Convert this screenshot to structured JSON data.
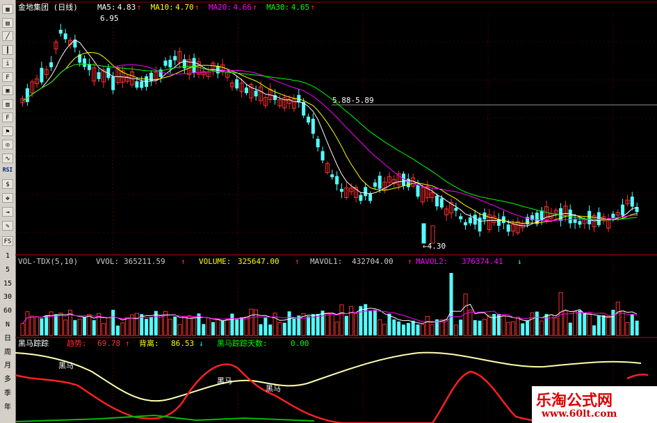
{
  "window": {
    "title": "金地集团 (日线)"
  },
  "toolbar": {
    "buttons": [
      {
        "icon": "grid-icon"
      },
      {
        "icon": "table-icon"
      },
      {
        "icon": "line-icon"
      },
      {
        "icon": "candle-icon"
      },
      {
        "icon": "info-icon"
      },
      {
        "icon": "f10-icon"
      },
      {
        "icon": "document-icon"
      },
      {
        "icon": "chart-icon"
      },
      {
        "icon": "f2-icon"
      },
      {
        "icon": "flag-icon"
      },
      {
        "icon": "zoom-icon"
      },
      {
        "icon": "wave-icon"
      }
    ],
    "rsi_label": "RSI",
    "tools": [
      {
        "icon": "money-icon"
      },
      {
        "icon": "move-icon"
      },
      {
        "icon": "exit-icon"
      },
      {
        "icon": "pencil-icon"
      }
    ],
    "fs_label": "FS",
    "periods": [
      "1",
      "5",
      "15",
      "30",
      "60",
      "N",
      "日",
      "周",
      "月",
      "多",
      "季",
      "年"
    ]
  },
  "main_panel": {
    "title": "金地集团 (日线)",
    "indicators": [
      {
        "label": "MA5:",
        "value": "4.83",
        "arrow": "↑",
        "color": "#ffffff"
      },
      {
        "label": "MA10:",
        "value": "4.70",
        "arrow": "↑",
        "color": "#ffff00"
      },
      {
        "label": "MA20:",
        "value": "4.66",
        "arrow": "↑",
        "color": "#ff00ff"
      },
      {
        "label": "MA30:",
        "value": "4.65",
        "arrow": "↑",
        "color": "#00ff00"
      }
    ],
    "high_label": "6.95",
    "mid_label": "5.88-5.89",
    "low_label": "←4.30"
  },
  "volume_panel": {
    "title": "VOL-TDX(5,10)",
    "vvol_label": "VVOL:",
    "vvol_value": "365211.59",
    "vvol_arrow": "↑",
    "volume_label": "VOLUME:",
    "volume_value": "325647.00",
    "volume_arrow": "↑",
    "mavol1_label": "MAVOL1:",
    "mavol1_value": "432704.00",
    "mavol1_arrow": "↑",
    "mavol2_label": "MAVOL2:",
    "mavol2_value": "376374.41",
    "mavol2_arrow": "↓"
  },
  "indicator_panel": {
    "title": "黑马踪踪",
    "trend_label": "趋势:",
    "trend_value": "69.78",
    "trend_arrow": "↑",
    "divergence_label": "背离:",
    "divergence_value": "86.53",
    "divergence_arrow": "↓",
    "days_label": "黑马踪踪天数:",
    "days_value": "0.00",
    "signals": [
      "黑马",
      "黑马",
      "黑马"
    ]
  },
  "watermark": {
    "title": "乐淘公式网",
    "url": "www.60lt.com"
  },
  "colors": {
    "up": "#ff3030",
    "down": "#54ffff",
    "ma5": "#ffffff",
    "ma10": "#ffff00",
    "ma20": "#ff00ff",
    "ma30": "#00ff00",
    "grid": "#8b0000"
  }
}
